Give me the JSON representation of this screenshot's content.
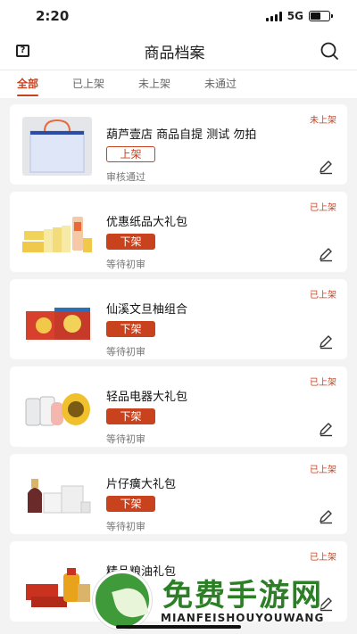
{
  "status_bar": {
    "time": "2:20",
    "network": "5G"
  },
  "header": {
    "title": "商品档案",
    "help_icon": "question-box-icon",
    "search_icon": "search-icon"
  },
  "tabs": [
    {
      "label": "全部",
      "active": true
    },
    {
      "label": "已上架",
      "active": false
    },
    {
      "label": "未上架",
      "active": false
    },
    {
      "label": "未通过",
      "active": false
    }
  ],
  "products": [
    {
      "name": "葫芦壹店 商品自提 测试 勿拍",
      "action": "上架",
      "review": "审核通过",
      "status": "未上架",
      "image": "shopping-bag"
    },
    {
      "name": "优惠纸品大礼包",
      "action": "下架",
      "review": "等待初审",
      "status": "已上架",
      "image": "paper-products"
    },
    {
      "name": "仙溪文旦柚组合",
      "action": "下架",
      "review": "等待初审",
      "status": "已上架",
      "image": "pomelo-box"
    },
    {
      "name": "轻品电器大礼包",
      "action": "下架",
      "review": "等待初审",
      "status": "已上架",
      "image": "appliances"
    },
    {
      "name": "片仔癀大礼包",
      "action": "下架",
      "review": "等待初审",
      "status": "已上架",
      "image": "cosmetics"
    },
    {
      "name": "精品粮油礼包",
      "action": "",
      "review": "",
      "status": "已上架",
      "image": "grain-oil"
    }
  ],
  "colors": {
    "accent": "#c9421e",
    "background": "#f3f3f3"
  },
  "watermark": {
    "title": "免费手游网",
    "subtitle": "MIANFEISHOUYOUWANG"
  }
}
